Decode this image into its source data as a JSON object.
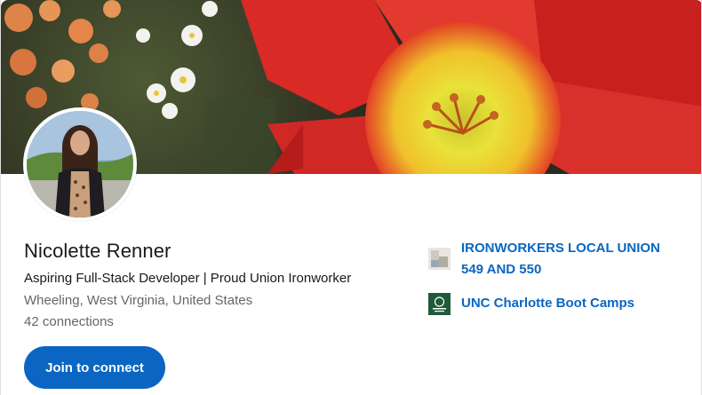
{
  "profile": {
    "name": "Nicolette Renner",
    "headline": "Aspiring Full-Stack Developer | Proud Union Ironworker",
    "location": "Wheeling, West Virginia, United States",
    "connections": "42 connections"
  },
  "actions": {
    "connect_label": "Join to connect"
  },
  "organizations": [
    {
      "name": "IRONWORKERS LOCAL UNION 549 AND 550",
      "logo_icon": "building-placeholder-icon"
    },
    {
      "name": "UNC Charlotte Boot Camps",
      "logo_icon": "unc-charlotte-logo-icon"
    }
  ],
  "colors": {
    "accent": "#0a66c2",
    "text_primary": "#191919",
    "text_secondary": "#666666"
  }
}
